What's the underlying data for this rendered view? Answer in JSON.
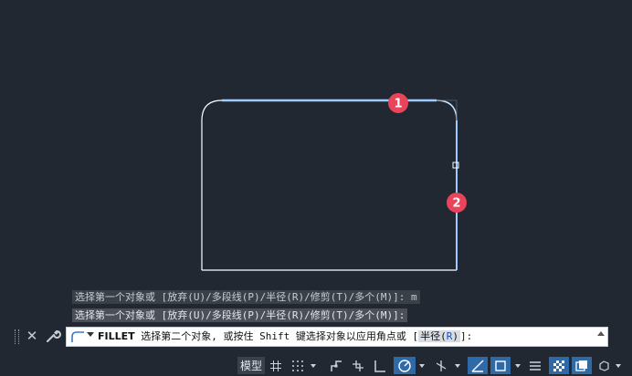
{
  "colors": {
    "background": "#212832",
    "geometry": "#ffffff",
    "highlight": "#a8d4ff",
    "marker": "#e8445a"
  },
  "markers": [
    "1",
    "2"
  ],
  "history": [
    "选择第一个对象或 [放弃(U)/多段线(P)/半径(R)/修剪(T)/多个(M)]: m",
    "选择第一个对象或 [放弃(U)/多段线(P)/半径(R)/修剪(T)/多个(M)]:"
  ],
  "command": {
    "name": "FILLET",
    "prompt": " 选择第二个对象, 或按住 Shift 键选择对象以应用角点或 [",
    "option_label": "半径(",
    "option_key": "R",
    "option_close": ")",
    "suffix": "]:"
  },
  "status": {
    "model_label": "模型",
    "icons": [
      "grid-icon",
      "snap-icon",
      "infer-icon",
      "dynamic-ucs-icon",
      "ortho-icon",
      "polar-icon",
      "isodraft-icon",
      "osnap-track-icon",
      "osnap-icon",
      "lineweight-icon",
      "transparency-icon",
      "selection-cycling-icon",
      "annotation-icon"
    ]
  }
}
